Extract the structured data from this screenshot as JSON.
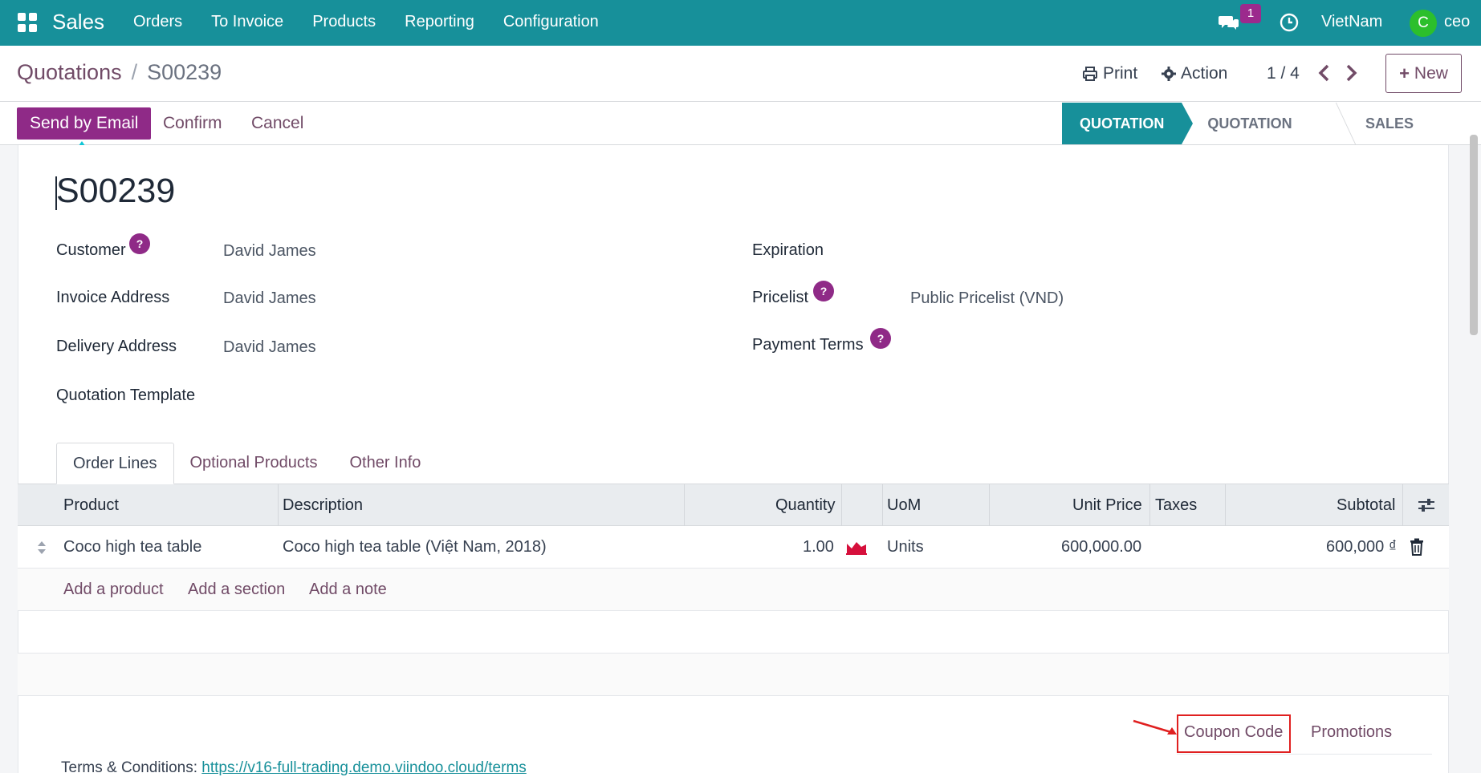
{
  "navbar": {
    "app_name": "Sales",
    "menu": [
      "Orders",
      "To Invoice",
      "Products",
      "Reporting",
      "Configuration"
    ],
    "chat_count": "1",
    "company": "VietNam",
    "avatar_initial": "C",
    "user": "ceo"
  },
  "control_panel": {
    "breadcrumb_parent": "Quotations",
    "breadcrumb_sep": "/",
    "breadcrumb_current": "S00239",
    "print_label": "Print",
    "action_label": "Action",
    "pager": "1 / 4",
    "new_label": "New"
  },
  "statusbar": {
    "send_email": "Send by Email",
    "confirm": "Confirm",
    "cancel": "Cancel",
    "stages": [
      "QUOTATION",
      "QUOTATION SENT",
      "SALES ORDER"
    ],
    "active_stage": "QUOTATION"
  },
  "form": {
    "name": "S00239",
    "customer_label": "Customer",
    "customer_value": "David James",
    "invoice_address_label": "Invoice Address",
    "invoice_address_value": "David James",
    "delivery_address_label": "Delivery Address",
    "delivery_address_value": "David James",
    "quotation_template_label": "Quotation Template",
    "expiration_label": "Expiration",
    "pricelist_label": "Pricelist",
    "pricelist_value": "Public Pricelist (VND)",
    "payment_terms_label": "Payment Terms",
    "help_glyph": "?"
  },
  "tabs": [
    "Order Lines",
    "Optional Products",
    "Other Info"
  ],
  "order_lines": {
    "columns": [
      "Product",
      "Description",
      "Quantity",
      "UoM",
      "Unit Price",
      "Taxes",
      "Subtotal"
    ],
    "rows": [
      {
        "product": "Coco high tea table",
        "description": "Coco high tea table (Việt Nam, 2018)",
        "quantity": "1.00",
        "uom": "Units",
        "unit_price": "600,000.00",
        "taxes": "",
        "subtotal": "600,000 ₫"
      }
    ],
    "add_product": "Add a product",
    "add_section": "Add a section",
    "add_note": "Add a note"
  },
  "footer": {
    "coupon_code": "Coupon Code",
    "promotions": "Promotions",
    "terms_label": "Terms & Conditions:",
    "terms_url": "https://v16-full-trading.demo.viindoo.cloud/terms"
  },
  "colors": {
    "navbar": "#17909a",
    "primary": "#8f2a87",
    "link": "#714b67",
    "highlight": "#e02020"
  }
}
